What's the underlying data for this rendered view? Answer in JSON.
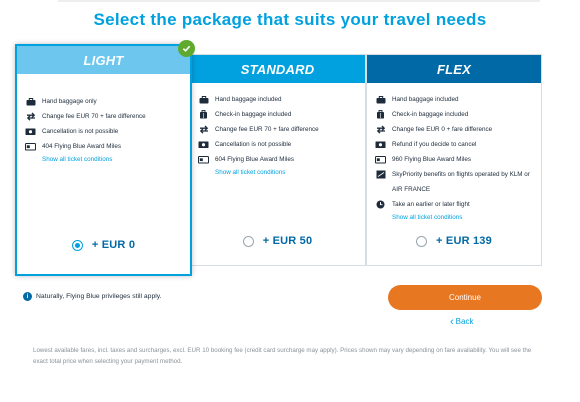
{
  "page": {
    "title": "Select the package that suits your travel needs"
  },
  "colors": {
    "light": "#6cc6ee",
    "standard": "#00a1de",
    "flex": "#0069a6",
    "accent": "#00a1de",
    "cta": "#e87722",
    "selected_badge": "#5faa2e"
  },
  "packages": [
    {
      "name": "LIGHT",
      "selected": true,
      "price": "+ EUR 0",
      "link": "Show all ticket conditions",
      "features": [
        {
          "icon": "briefcase-icon",
          "text": "Hand baggage only"
        },
        {
          "icon": "change-arrows-icon",
          "text": "Change fee EUR 70 + fare difference"
        },
        {
          "icon": "cash-icon",
          "text": "Cancellation is not possible"
        },
        {
          "icon": "miles-card-icon",
          "text": "404 Flying Blue Award Miles"
        }
      ]
    },
    {
      "name": "STANDARD",
      "selected": false,
      "price": "+ EUR 50",
      "link": "Show all ticket conditions",
      "features": [
        {
          "icon": "briefcase-icon",
          "text": "Hand baggage included"
        },
        {
          "icon": "suitcase-icon",
          "text": "Check-in baggage included"
        },
        {
          "icon": "change-arrows-icon",
          "text": "Change fee EUR 70 + fare difference"
        },
        {
          "icon": "cash-icon",
          "text": "Cancellation is not possible"
        },
        {
          "icon": "miles-card-icon",
          "text": "604 Flying Blue Award Miles"
        }
      ]
    },
    {
      "name": "FLEX",
      "selected": false,
      "price": "+ EUR 139",
      "link": "Show all ticket conditions",
      "features": [
        {
          "icon": "briefcase-icon",
          "text": "Hand baggage included"
        },
        {
          "icon": "suitcase-icon",
          "text": "Check-in baggage included"
        },
        {
          "icon": "change-arrows-icon",
          "text": "Change fee EUR 0 + fare difference"
        },
        {
          "icon": "cash-icon",
          "text": "Refund if you decide to cancel"
        },
        {
          "icon": "miles-card-icon",
          "text": "960 Flying Blue Award Miles"
        },
        {
          "icon": "skypriority-icon",
          "text": "SkyPriority benefits on flights operated by KLM or AIR FRANCE"
        },
        {
          "icon": "clock-icon",
          "text": "Take an earlier or later flight"
        }
      ]
    }
  ],
  "note": "Naturally, Flying Blue privileges still apply.",
  "continue_label": "Continue",
  "back_label": "Back",
  "footnote": "Lowest available fares, incl. taxes and surcharges, excl. EUR 10 booking fee (credit card surcharge may apply). Prices shown may vary depending on fare availability. You will see the exact total price when selecting your payment method."
}
